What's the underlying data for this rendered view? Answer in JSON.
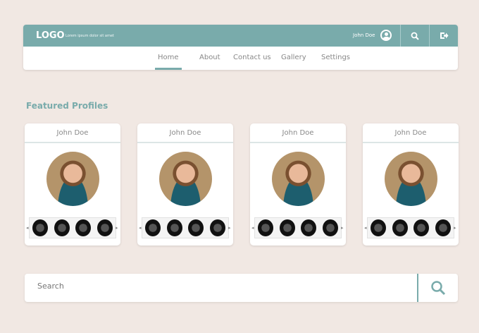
{
  "header": {
    "logo": "LOGO",
    "tagline": "Lorem ipsum dolor sit amet",
    "user_name": "John Doe"
  },
  "nav": {
    "items": [
      {
        "label": "Home"
      },
      {
        "label": "About"
      },
      {
        "label": "Contact us"
      },
      {
        "label": "Gallery"
      },
      {
        "label": "Settings"
      }
    ],
    "active": "Home"
  },
  "section_title": "Featured Profiles",
  "profiles": [
    {
      "name": "John Doe"
    },
    {
      "name": "John Doe"
    },
    {
      "name": "John Doe"
    },
    {
      "name": "John Doe"
    }
  ],
  "search": {
    "placeholder": "Search"
  },
  "colors": {
    "accent": "#79abab",
    "background": "#f1e8e3"
  }
}
